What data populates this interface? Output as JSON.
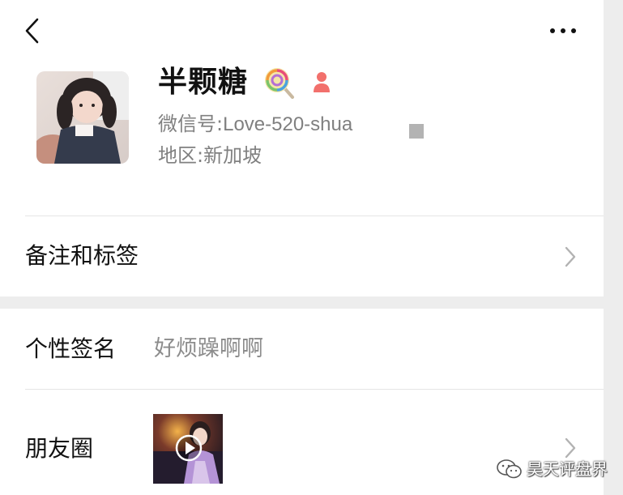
{
  "profile": {
    "nickname": "半颗糖",
    "wechat_id_label": "微信号:",
    "wechat_id": "Love-520-shua",
    "region_label": "地区:",
    "region": "新加坡"
  },
  "rows": {
    "remark": {
      "label": "备注和标签"
    },
    "signature": {
      "label": "个性签名",
      "value": "好烦躁啊啊"
    },
    "moments": {
      "label": "朋友圈"
    }
  },
  "watermark": {
    "text": "昊天评盘界"
  },
  "icons": {
    "back": "back-icon",
    "more": "more-icon",
    "lollipop": "lollipop-icon",
    "gender": "female-icon",
    "qr": "qr-code-icon",
    "chevron": "chevron-right-icon",
    "play": "play-icon"
  },
  "colors": {
    "gender_badge": "#f2706c",
    "secondary_text": "#808080",
    "separator_band": "#ededed"
  }
}
